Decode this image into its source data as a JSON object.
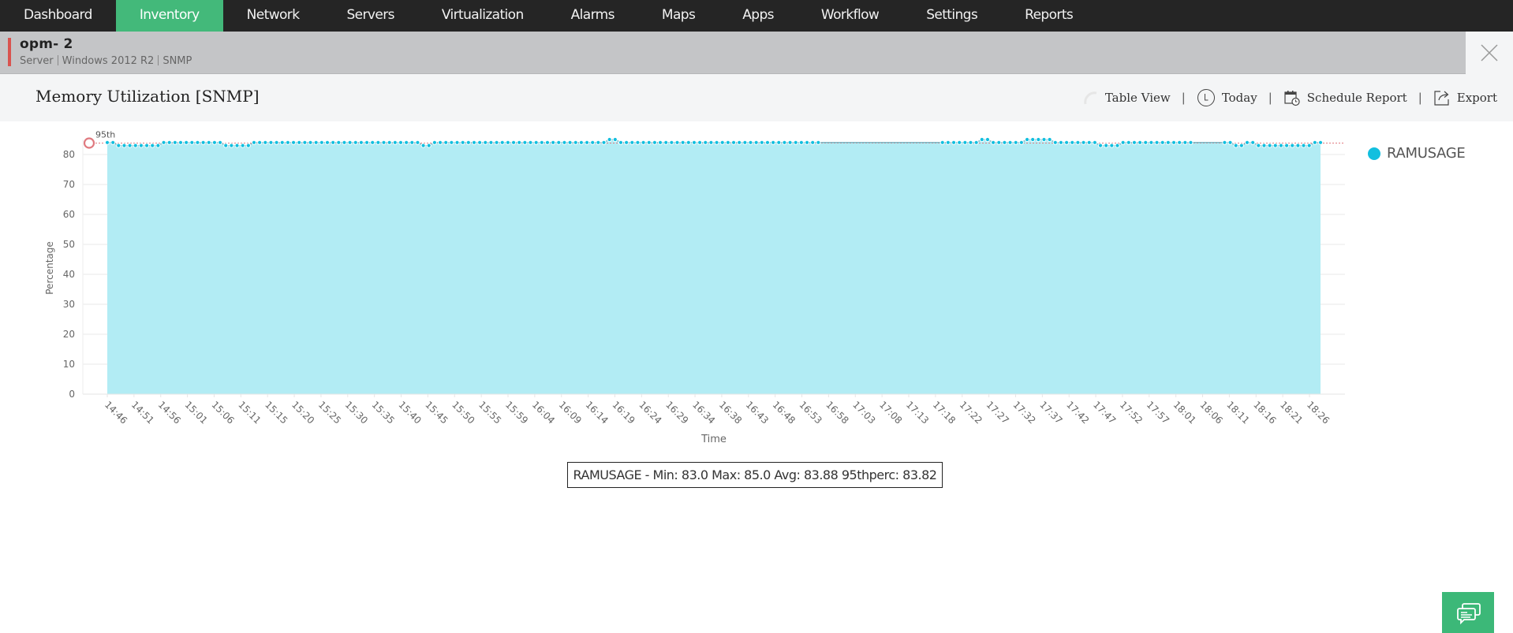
{
  "nav": {
    "items": [
      {
        "label": "Dashboard",
        "active": false
      },
      {
        "label": "Inventory",
        "active": true
      },
      {
        "label": "Network",
        "active": false
      },
      {
        "label": "Servers",
        "active": false
      },
      {
        "label": "Virtualization",
        "active": false
      },
      {
        "label": "Alarms",
        "active": false
      },
      {
        "label": "Maps",
        "active": false
      },
      {
        "label": "Apps",
        "active": false
      },
      {
        "label": "Workflow",
        "active": false
      },
      {
        "label": "Settings",
        "active": false
      },
      {
        "label": "Reports",
        "active": false
      }
    ]
  },
  "device": {
    "name": "opm-        2",
    "type": "Server",
    "os": "Windows 2012 R2",
    "protocol": "SNMP",
    "status_color": "#d9534f"
  },
  "header": {
    "title": "Memory Utilization [SNMP]",
    "table_view": "Table View",
    "period": "Today",
    "schedule_report": "Schedule Report",
    "export": "Export",
    "separator": "|"
  },
  "legend": {
    "series_name": "RAMUSAGE",
    "color": "#12bfdf"
  },
  "stats": {
    "text": "RAMUSAGE - Min: 83.0 Max: 85.0 Avg: 83.88 95thperc: 83.82"
  },
  "chart_data": {
    "type": "area",
    "title": "Memory Utilization [SNMP]",
    "xlabel": "Time",
    "ylabel": "Percentage",
    "ylim": [
      0,
      85
    ],
    "yticks": [
      0,
      10,
      20,
      30,
      40,
      50,
      60,
      70,
      80
    ],
    "grid": true,
    "legend_position": "right",
    "x_start": "14:46",
    "x_end": "18:28",
    "x_interval_minutes": 1,
    "xtick_labels": [
      "14:46",
      "14:51",
      "14:56",
      "15:01",
      "15:06",
      "15:11",
      "15:15",
      "15:20",
      "15:25",
      "15:30",
      "15:35",
      "15:40",
      "15:45",
      "15:50",
      "15:55",
      "15:59",
      "16:04",
      "16:09",
      "16:14",
      "16:19",
      "16:24",
      "16:29",
      "16:34",
      "16:38",
      "16:43",
      "16:48",
      "16:53",
      "16:58",
      "17:03",
      "17:08",
      "17:13",
      "17:18",
      "17:22",
      "17:27",
      "17:32",
      "17:37",
      "17:42",
      "17:47",
      "17:52",
      "17:57",
      "18:01",
      "18:06",
      "18:11",
      "18:16",
      "18:21",
      "18:26"
    ],
    "percentile_line": {
      "label": "95th",
      "value": 83.82,
      "color": "#e07a80"
    },
    "series": [
      {
        "name": "RAMUSAGE",
        "color": "#12bfdf",
        "fill": "#b2ecf4",
        "runs": [
          {
            "value": 84,
            "count": 2
          },
          {
            "value": 83,
            "count": 8
          },
          {
            "value": 84,
            "count": 11
          },
          {
            "value": 83,
            "count": 5
          },
          {
            "value": 84,
            "count": 30
          },
          {
            "value": 83,
            "count": 2
          },
          {
            "value": 84,
            "count": 26
          },
          {
            "value": 84,
            "count": 5
          },
          {
            "value": 85,
            "count": 2
          },
          {
            "value": 84,
            "count": 36
          },
          {
            "value": 84,
            "count": 21,
            "gap": true
          },
          {
            "value": 84,
            "count": 7
          },
          {
            "value": 85,
            "count": 2
          },
          {
            "value": 84,
            "count": 6
          },
          {
            "value": 85,
            "count": 5
          },
          {
            "value": 84,
            "count": 8
          },
          {
            "value": 83,
            "count": 4
          },
          {
            "value": 84,
            "count": 13
          },
          {
            "value": 84,
            "count": 5,
            "gap": true
          },
          {
            "value": 84,
            "count": 2
          },
          {
            "value": 83,
            "count": 2
          },
          {
            "value": 84,
            "count": 2
          },
          {
            "value": 83,
            "count": 10
          },
          {
            "value": 84,
            "count": 2
          }
        ]
      }
    ]
  },
  "chat": {
    "icon": "chat-icon"
  }
}
